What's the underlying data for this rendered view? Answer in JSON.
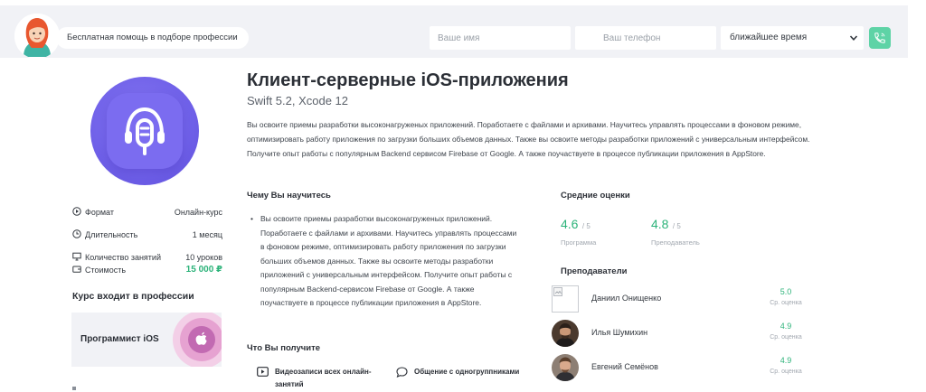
{
  "header": {
    "help_text": "Бесплатная помощь в подборе профессии",
    "name_placeholder": "Ваше имя",
    "phone_placeholder": "Ваш телефон",
    "time_select_value": "ближайшее время"
  },
  "sidebar": {
    "props": [
      {
        "label": "Формат",
        "value": "Онлайн-курс"
      },
      {
        "label": "Длительность",
        "value": "1 месяц"
      },
      {
        "label": "Количество занятий",
        "value": "10 уроков"
      },
      {
        "label": "Стоимость",
        "value": "15 000 ₽"
      }
    ],
    "profession_title": "Курс входит в профессии",
    "profession_name": "Программист iOS"
  },
  "course": {
    "title": "Клиент-серверные iOS-приложения",
    "subtitle": "Swift 5.2, Xcode 12",
    "description": "Вы освоите приемы разработки высоконагруженых приложений. Поработаете с файлами и архивами. Научитесь управлять процессами в фоновом режиме, оптимизировать работу приложения по загрузки больших объемов данных. Также вы освоите методы разработки приложений с универсальным интерфейсом. Получите опыт работы с популярным Backend сервисом Firebase от Google. А также поучаствуете в процессе публикации приложения в AppStore."
  },
  "learn": {
    "title": "Чему Вы научитесь",
    "items": [
      "Вы освоите приемы разработки высоконагруженых приложений. Поработаете с файлами и архивами. Научитесь управлять процессами в фоновом режиме, оптимизировать работу приложения по загрузки больших объемов данных. Также вы освоите методы разработки приложений с универсальным интерфейсом. Получите опыт работы с популярным Backend-сервисом Firebase от Google. А также поучаствуете в процессе публикации приложения в AppStore."
    ]
  },
  "get": {
    "title": "Что Вы получите",
    "items": [
      {
        "icon": "video-icon",
        "text": "Видеозаписи всех онлайн-занятий"
      },
      {
        "icon": "chat-icon",
        "text": "Общение с одногруппниками"
      }
    ]
  },
  "ratings": {
    "title": "Средние оценки",
    "items": [
      {
        "value": "4.6",
        "max": "/ 5",
        "caption": "Программа"
      },
      {
        "value": "4.8",
        "max": "/ 5",
        "caption": "Преподаватель"
      }
    ]
  },
  "teachers": {
    "title": "Преподаватели",
    "items": [
      {
        "name": "Даниил Онищенко",
        "score": "5.0",
        "caption": "Ср. оценка"
      },
      {
        "name": "Илья Шумихин",
        "score": "4.9",
        "caption": "Ср. оценка"
      },
      {
        "name": "Евгений Семёнов",
        "score": "4.9",
        "caption": "Ср. оценка"
      }
    ]
  },
  "colors": {
    "accent_green": "#2db37a",
    "call_button": "#5ed3a6",
    "course_icon": "#6f60e8",
    "top_band": "#f1f2f6"
  }
}
